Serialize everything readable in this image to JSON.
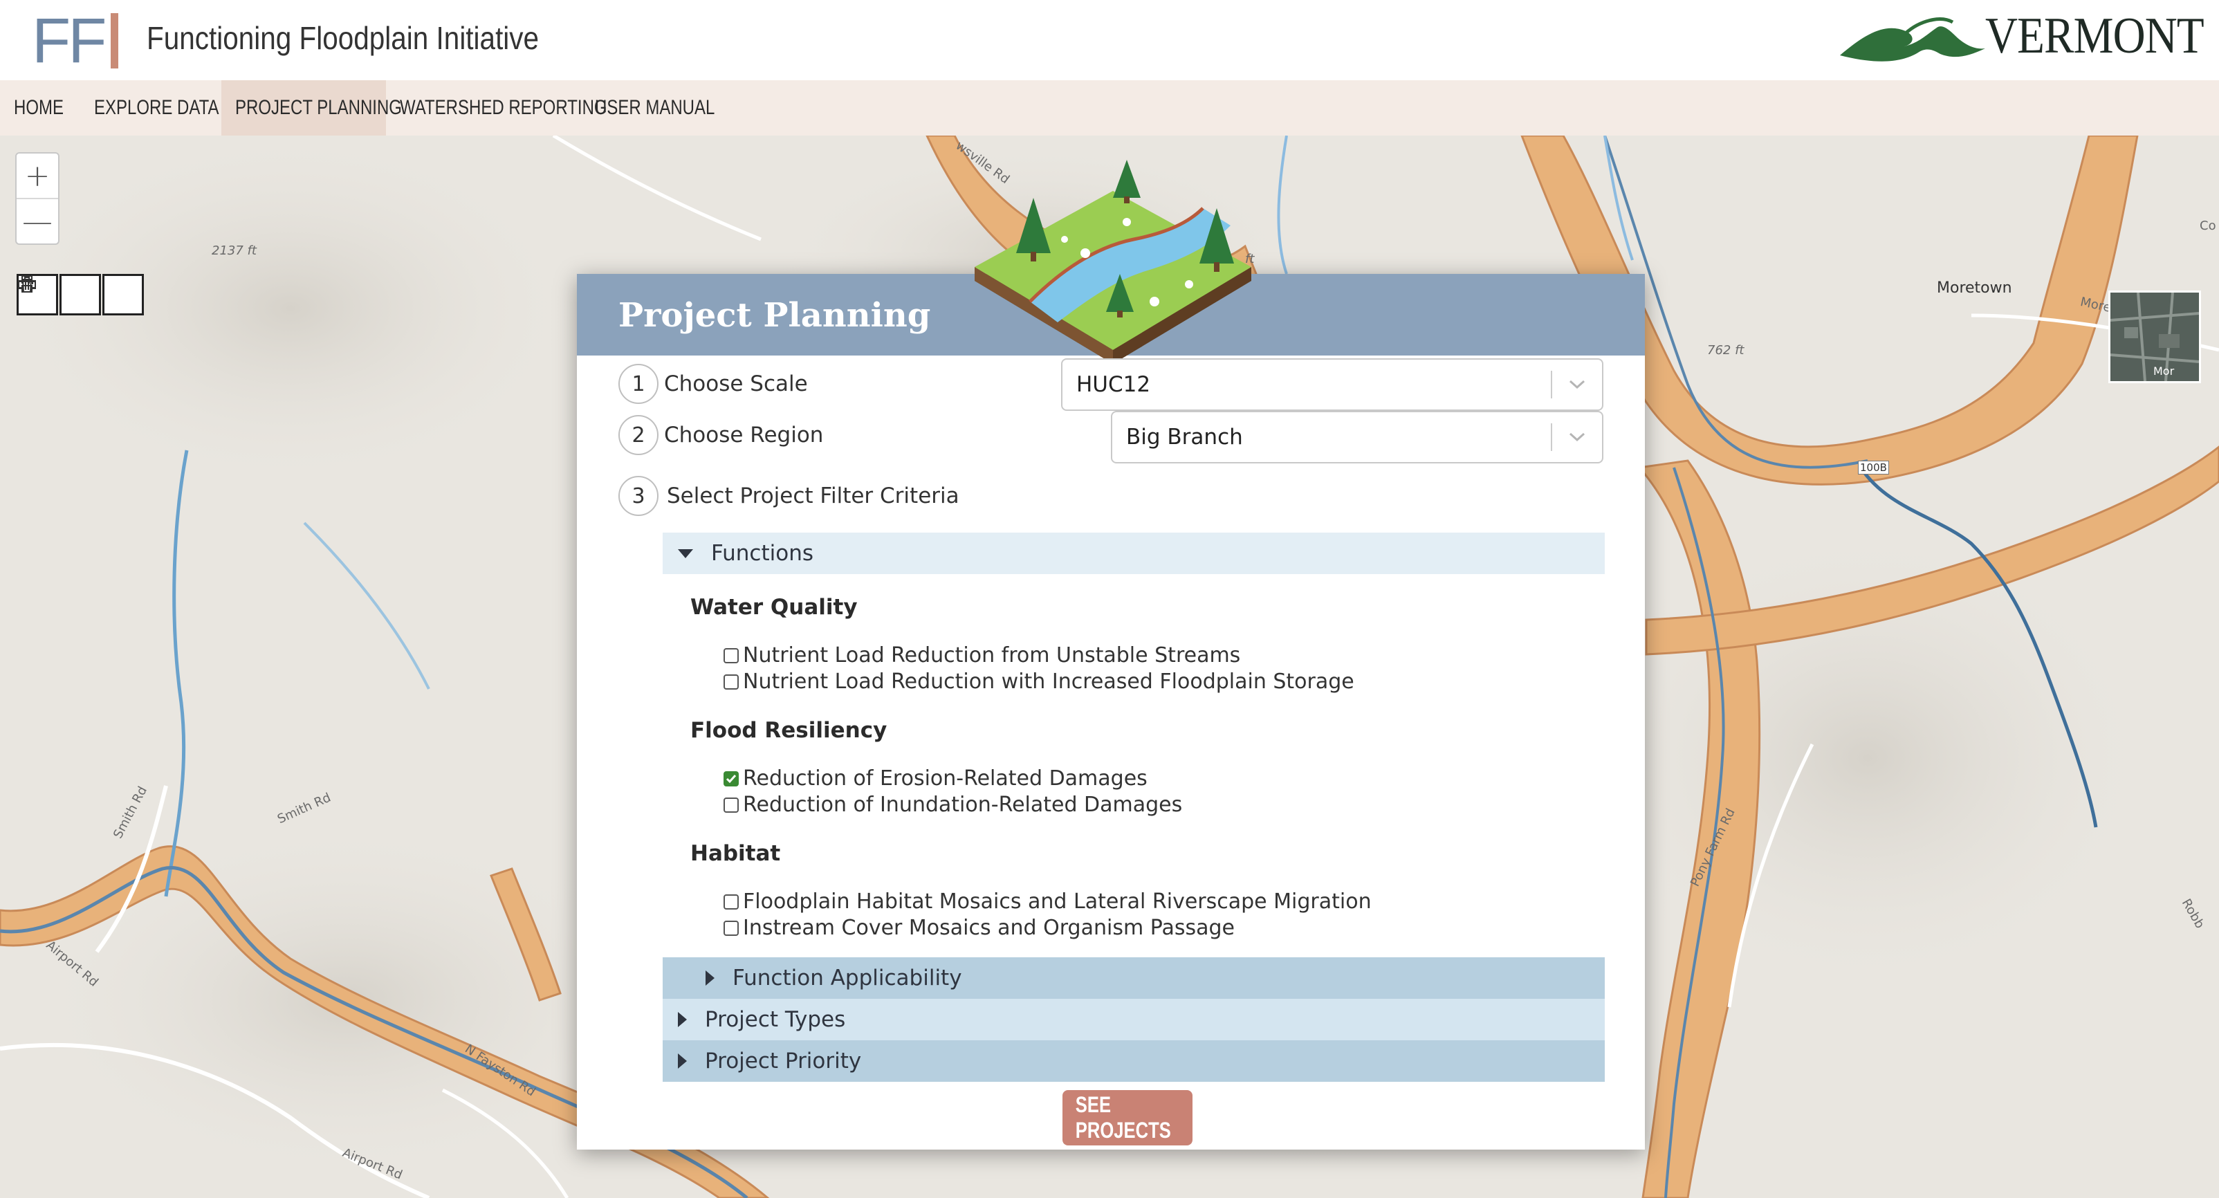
{
  "header": {
    "logo_text": "FF",
    "title": "Functioning Floodplain Initiative",
    "state_logo_text": "VERMONT"
  },
  "nav": {
    "items": [
      {
        "label": "HOME"
      },
      {
        "label": "EXPLORE DATA"
      },
      {
        "label": "PROJECT PLANNING",
        "active": true
      },
      {
        "label": "WATERSHED REPORTING"
      },
      {
        "label": "USER MANUAL"
      }
    ]
  },
  "map": {
    "zoom_in": "+",
    "zoom_out": "—",
    "labels": {
      "elev1": "2137 ft",
      "elev2": "762 ft",
      "moretown": "Moretown",
      "moretown_mtn": "Moretown Mountain",
      "smith_rd_1": "Smith Rd",
      "smith_rd_2": "Smith Rd",
      "airport_rd_1": "Airport Rd",
      "airport_rd_2": "Airport Rd",
      "n_fayston_rd": "N Fayston Rd",
      "pony_farm_rd": "Pony Farm Rd",
      "rt_100b": "100B",
      "top_rd": "wsville Rd",
      "top_elev": "ft",
      "thumb_label": "Mor",
      "edge_co": "Co",
      "edge_robb": "Robb"
    },
    "tools": [
      "ruler-icon",
      "print-icon",
      "trash-icon"
    ],
    "colors": {
      "base": "#e9e6e0",
      "floodplain": "#e8b27a",
      "river": "#5a86ad"
    }
  },
  "modal": {
    "title": "Project Planning",
    "steps": [
      {
        "num": "1",
        "label": "Choose Scale",
        "value": "HUC12"
      },
      {
        "num": "2",
        "label": "Choose Region",
        "value": "Big Branch"
      },
      {
        "num": "3",
        "label": "Select Project Filter Criteria"
      }
    ],
    "functions_label": "Functions",
    "groups": [
      {
        "title": "Water Quality",
        "options": [
          {
            "label": "Nutrient Load Reduction from Unstable Streams",
            "checked": false
          },
          {
            "label": "Nutrient Load Reduction with Increased Floodplain Storage",
            "checked": false
          }
        ]
      },
      {
        "title": "Flood Resiliency",
        "options": [
          {
            "label": "Reduction of Erosion-Related Damages",
            "checked": true
          },
          {
            "label": "Reduction of Inundation-Related Damages",
            "checked": false
          }
        ]
      },
      {
        "title": "Habitat",
        "options": [
          {
            "label": "Floodplain Habitat Mosaics and Lateral Riverscape Migration",
            "checked": false
          },
          {
            "label": "Instream Cover Mosaics and Organism Passage",
            "checked": false
          }
        ]
      }
    ],
    "sections": {
      "function_applicability": "Function Applicability",
      "project_types": "Project Types",
      "project_priority": "Project Priority"
    },
    "see_projects": "SEE PROJECTS"
  }
}
